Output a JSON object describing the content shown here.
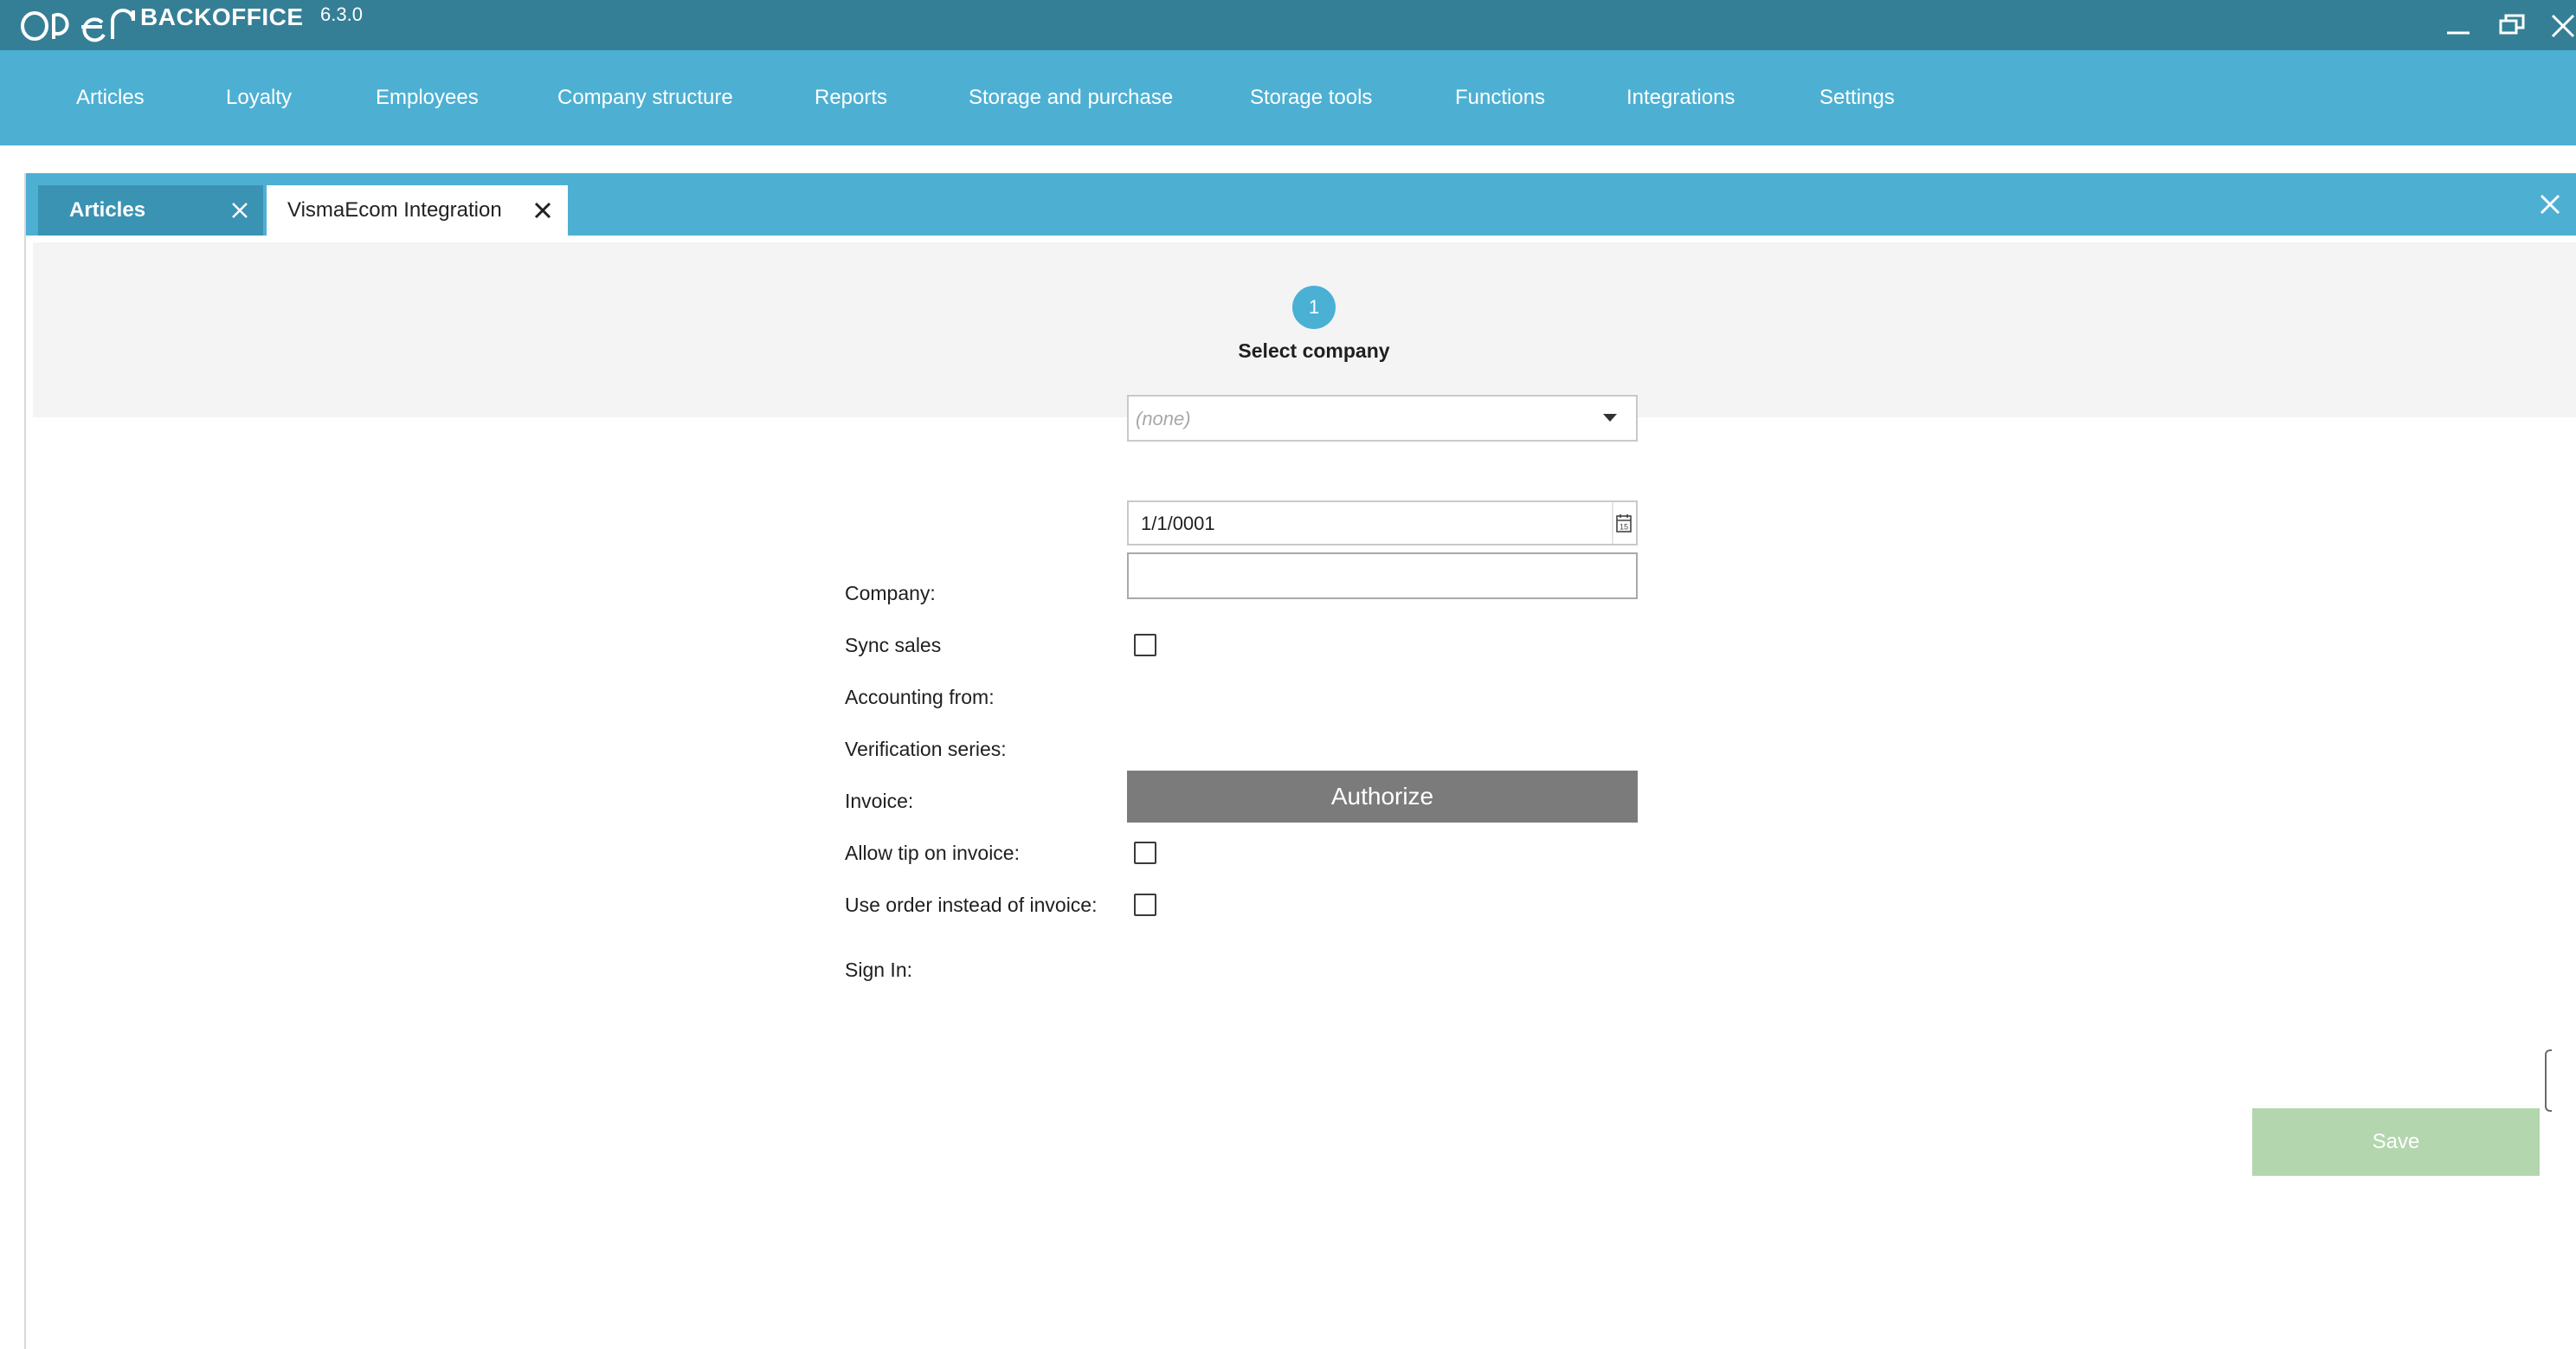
{
  "app": {
    "logo_text": "OPEN",
    "name": "BACKOFFICE",
    "version": "6.3.0"
  },
  "window_controls": {
    "minimize_icon": "minimize-icon",
    "restore_icon": "restore-icon",
    "close_icon": "close-icon"
  },
  "menu": {
    "items": [
      {
        "label": "Articles"
      },
      {
        "label": "Loyalty"
      },
      {
        "label": "Employees"
      },
      {
        "label": "Company structure"
      },
      {
        "label": "Reports"
      },
      {
        "label": "Storage and purchase"
      },
      {
        "label": "Storage tools"
      },
      {
        "label": "Functions"
      },
      {
        "label": "Integrations"
      },
      {
        "label": "Settings"
      }
    ]
  },
  "tabs": [
    {
      "label": "Articles",
      "active": false
    },
    {
      "label": "VismaEcom Integration",
      "active": true
    }
  ],
  "wizard": {
    "step_number": "1",
    "step_label": "Select company"
  },
  "form": {
    "company_label": "Company:",
    "company_value": "(none)",
    "sync_sales_label": "Sync sales",
    "accounting_from_label": "Accounting from:",
    "accounting_from_value": "1/1/0001",
    "verification_series_label": "Verification series:",
    "verification_series_value": "",
    "invoice_label": "Invoice:",
    "allow_tip_label": "Allow tip on invoice:",
    "use_order_label": "Use order instead of invoice:",
    "sign_in_label": "Sign In:",
    "authorize_label": "Authorize"
  },
  "footer": {
    "save_label": "Save"
  },
  "colors": {
    "titlebar": "#357f96",
    "menubar": "#4db0d3",
    "active_tab_bg": "#ffffff",
    "inactive_tab_bg": "#3a93b3",
    "step_accent": "#4ab0d4",
    "authorize_bg": "#7b7b7c",
    "save_bg": "#b3d6ae"
  }
}
